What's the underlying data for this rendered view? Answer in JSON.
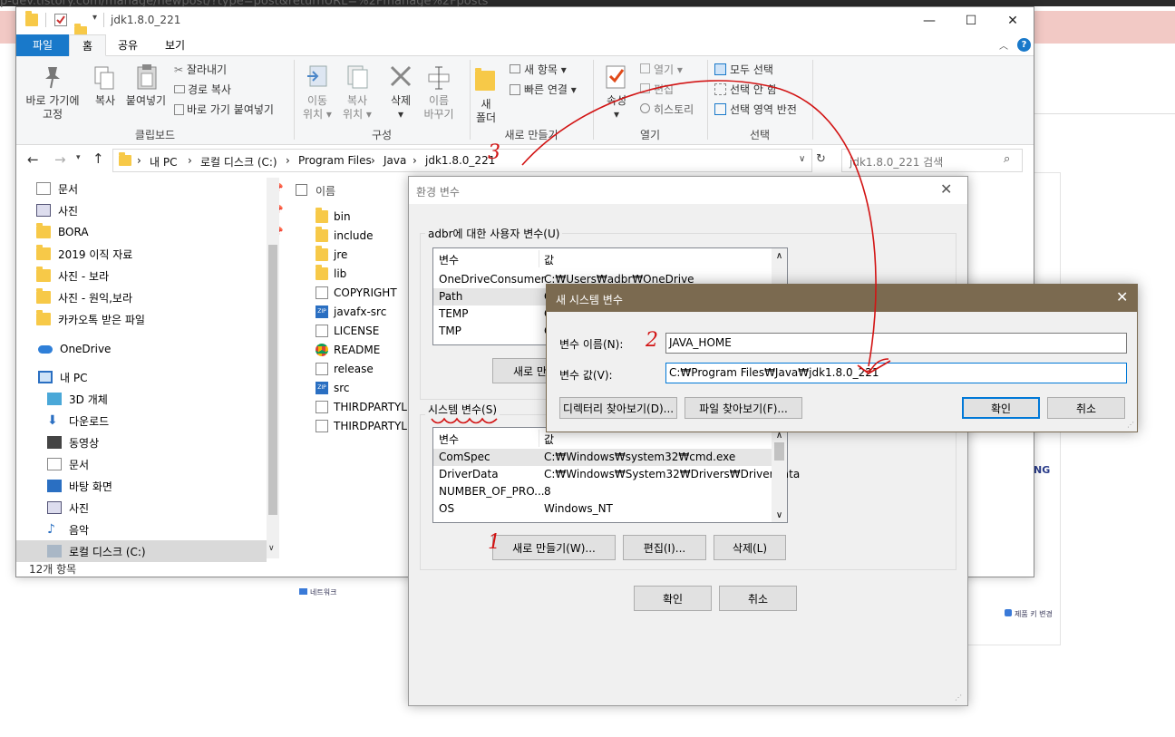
{
  "browser": {
    "url": "p-dev.tistory.com/manage/newpost/?type=post&returnURL=%2Fmanage%2Fposts"
  },
  "background": {
    "brand_fragment": "NG",
    "small_left": "네트워크",
    "small_right": "제품 키 변경"
  },
  "explorer": {
    "title": "jdk1.8.0_221",
    "tabs": [
      "파일",
      "홈",
      "공유",
      "보기"
    ],
    "ribbon": {
      "clipboard": {
        "pin_label": "바로 가기에\n고정",
        "copy": "복사",
        "paste": "붙여넣기",
        "cut": "잘라내기",
        "copy_path": "경로 복사",
        "paste_shortcut": "바로 가기 붙여넣기",
        "group": "클립보드"
      },
      "organize": {
        "move_to": "이동\n위치 ▾",
        "copy_to": "복사\n위치 ▾",
        "delete": "삭제",
        "rename": "이름\n바꾸기",
        "group": "구성"
      },
      "new": {
        "new_folder": "새\n폴더",
        "new_item": "새 항목 ▾",
        "easy_access": "빠른 연결 ▾",
        "group": "새로 만들기"
      },
      "open": {
        "properties": "속성",
        "open": "열기 ▾",
        "edit": "편집",
        "history": "히스토리",
        "group": "열기"
      },
      "select": {
        "select_all": "모두 선택",
        "select_none": "선택 안 함",
        "invert": "선택 영역 반전",
        "group": "선택"
      }
    },
    "address": {
      "crumbs": [
        "내 PC",
        "로컬 디스크 (C:)",
        "Program Files",
        "Java",
        "jdk1.8.0_221"
      ],
      "search_placeholder": "jdk1.8.0_221 검색"
    },
    "nav": [
      "문서",
      "사진",
      "BORA",
      "2019 이직 자료",
      "사진 - 보라",
      "사진 - 원익,보라",
      "카카오톡 받은 파일",
      "OneDrive",
      "내 PC",
      "3D 개체",
      "다운로드",
      "동영상",
      "문서",
      "바탕 화면",
      "사진",
      "음악",
      "로컬 디스크 (C:)"
    ],
    "file_header": "이름",
    "files": [
      "bin",
      "include",
      "jre",
      "lib",
      "COPYRIGHT",
      "javafx-src",
      "LICENSE",
      "README",
      "release",
      "src",
      "THIRDPARTYLIC",
      "THIRDPARTYLIC"
    ],
    "status": "12개 항목"
  },
  "env_dialog": {
    "title": "환경 변수",
    "user_group": "adbr에 대한 사용자 변수(U)",
    "col_var": "변수",
    "col_val": "값",
    "user_vars": [
      {
        "name": "OneDriveConsumer",
        "value": "C:₩Users₩adbr₩OneDrive"
      },
      {
        "name": "Path",
        "value": "C"
      },
      {
        "name": "TEMP",
        "value": "C"
      },
      {
        "name": "TMP",
        "value": "C"
      }
    ],
    "user_new": "새로 만",
    "system_group": "시스템 변수(S)",
    "system_vars": [
      {
        "name": "ComSpec",
        "value": "C:₩Windows₩system32₩cmd.exe"
      },
      {
        "name": "DriverData",
        "value": "C:₩Windows₩System32₩Drivers₩DriverData"
      },
      {
        "name": "NUMBER_OF_PRO...",
        "value": "8"
      },
      {
        "name": "OS",
        "value": "Windows_NT"
      }
    ],
    "btn_new": "새로 만들기(W)...",
    "btn_edit": "편집(I)...",
    "btn_delete": "삭제(L)",
    "ok": "확인",
    "cancel": "취소"
  },
  "new_var_dialog": {
    "title": "새 시스템 변수",
    "name_label": "변수 이름(N):",
    "name_value": "JAVA_HOME",
    "value_label": "변수 값(V):",
    "value_value": "C:₩Program Files₩Java₩jdk1.8.0_221",
    "browse_dir": "디렉터리 찾아보기(D)...",
    "browse_file": "파일 찾아보기(F)...",
    "ok": "확인",
    "cancel": "취소"
  },
  "annotations": {
    "step1": "1",
    "step2": "2",
    "step3": "3"
  },
  "colors": {
    "accent": "#1979ca",
    "annotation": "#d21414",
    "dialog_title": "#7b6a50"
  }
}
